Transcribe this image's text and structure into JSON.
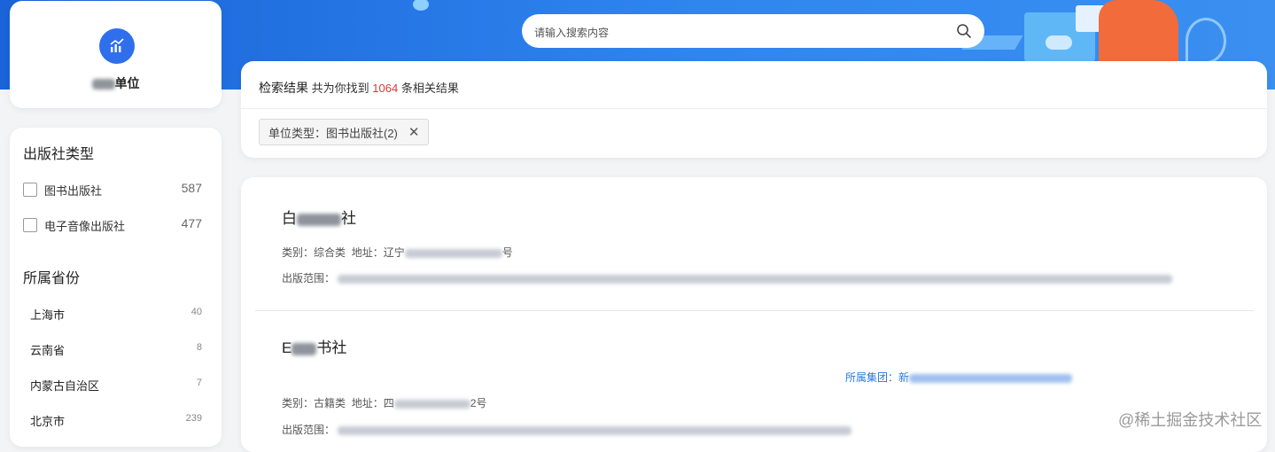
{
  "search": {
    "placeholder": "请输入搜索内容"
  },
  "unit": {
    "title": "单位"
  },
  "filters": {
    "publisher_type": {
      "title": "出版社类型",
      "options": [
        {
          "label": "图书出版社",
          "count": "587"
        },
        {
          "label": "电子音像出版社",
          "count": "477"
        }
      ]
    },
    "province": {
      "title": "所属省份",
      "items": [
        {
          "label": "上海市",
          "count": "40"
        },
        {
          "label": "云南省",
          "count": "8"
        },
        {
          "label": "内蒙古自治区",
          "count": "7"
        },
        {
          "label": "北京市",
          "count": "239"
        }
      ]
    }
  },
  "results": {
    "title": "检索结果",
    "summary_prefix": "共为你找到",
    "count": "1064",
    "summary_suffix": "条相关结果",
    "active_tag": "单位类型：图书出版社(2)"
  },
  "items": [
    {
      "name_a": "白",
      "name_b": "社",
      "category_label": "类别：",
      "category": "综合类",
      "address_label": "地址：",
      "address_a": "辽宁",
      "address_b": "号",
      "scope_label": "出版范围："
    },
    {
      "name_a": "E",
      "name_b": "书社",
      "group_label": "所属集团：",
      "group_a": "新",
      "category_label": "类别：",
      "category": "古籍类",
      "address_label": "地址：",
      "address_a": "四",
      "address_b": "2号",
      "scope_label": "出版范围："
    }
  ],
  "watermark": "@稀土掘金技术社区",
  "icons": {
    "logo": "chart-logo-icon",
    "search": "search-icon",
    "close": "close-icon"
  },
  "colors": {
    "accent": "#2f6fec",
    "count_red": "#e23636",
    "link_blue": "#2a7ad8"
  }
}
